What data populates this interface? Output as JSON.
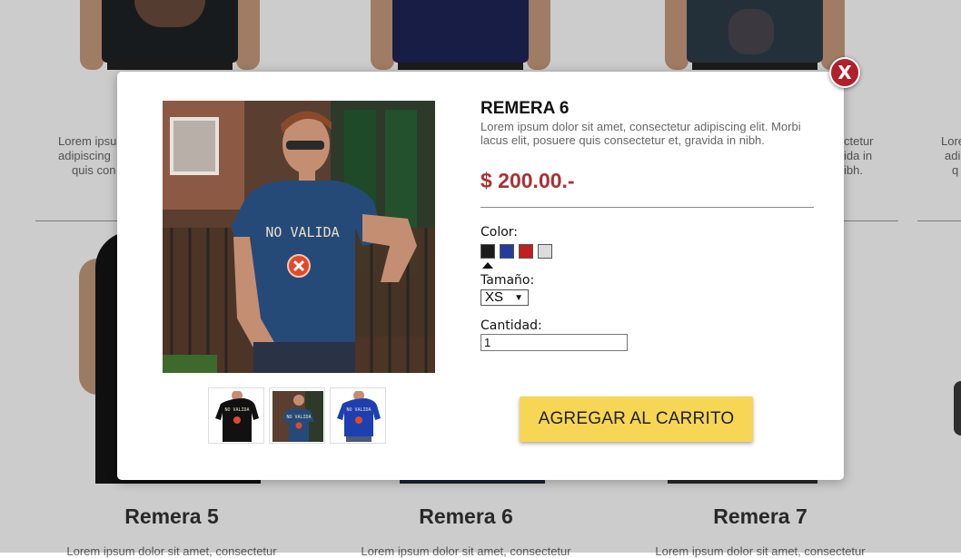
{
  "background": {
    "card_description": "Lorem ipsum dolor sit amet, consectetur adipiscing elit. Morbi lacus elit, posuere quis consectetur et, gravida in nibh.",
    "desc_left_line1": "Lorem ipsu",
    "desc_left_line2": "adipiscing",
    "desc_left_line3": "quis con",
    "desc_right_line1": "ctetur",
    "desc_right_line2": "ida in",
    "desc_right_line3": "ibh.",
    "desc_far_line1": "Lore",
    "desc_far_line2": "adi",
    "desc_far_line3": "q",
    "products": [
      {
        "name": "Remera 5"
      },
      {
        "name": "Remera 6"
      },
      {
        "name": "Remera 7"
      }
    ],
    "bottom_desc": "Lorem ipsum dolor sit amet, consectetur"
  },
  "modal": {
    "close_label": "X",
    "main_image_text": "NO VALIDA",
    "thumb_texts": [
      "NO VALIDA",
      "NO VALIDA",
      "NO VALIDA"
    ],
    "title": "REMERA 6",
    "description": "Lorem ipsum dolor sit amet, consectetur adipiscing elit. Morbi lacus elit, posuere quis consectetur et, gravida in nibh.",
    "price": "$ 200.00.-",
    "color_label": "Color:",
    "colors": [
      "#1c1c1c",
      "#263c9c",
      "#c02020",
      "#dcdcdc"
    ],
    "selected_color_index": 0,
    "size_label": "Tamaño:",
    "size_value": "XS",
    "quantity_label": "Cantidad:",
    "quantity_value": "1",
    "add_to_cart": "AGREGAR AL CARRITO",
    "accent_color": "#f7d555",
    "price_color": "#a83232",
    "close_color": "#b21f2d"
  }
}
